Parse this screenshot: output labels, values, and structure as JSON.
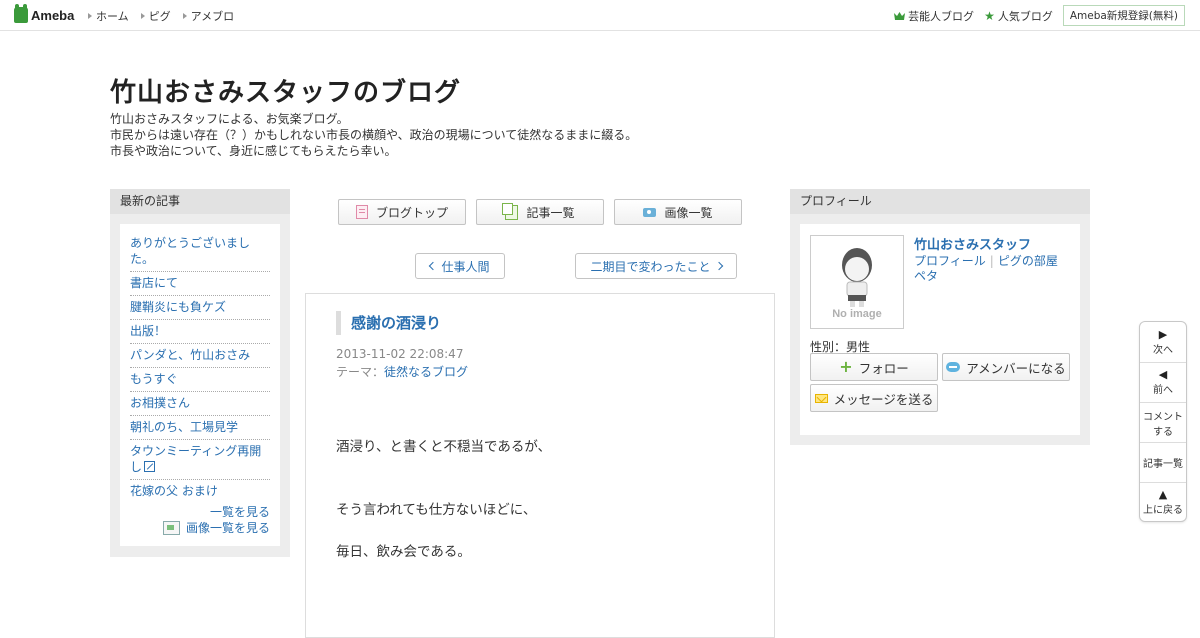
{
  "topbar": {
    "logo": "Ameba",
    "nav": [
      "ホーム",
      "ピグ",
      "アメブロ"
    ],
    "right": {
      "celeb_blog": "芸能人ブログ",
      "popular_blog": "人気ブログ",
      "register": "Ameba新規登録(無料)"
    }
  },
  "header": {
    "title": "竹山おさみスタッフのブログ",
    "description": [
      "竹山おさみスタッフによる、お気楽ブログ。",
      "市民からは遠い存在（？）かもしれない市長の横顔や、政治の現場について徒然なるままに綴る。",
      "市長や政治について、身近に感じてもらえたら幸い。"
    ]
  },
  "recent": {
    "heading": "最新の記事",
    "items": [
      "ありがとうございました。",
      "書店にて",
      "腱鞘炎にも負ケズ",
      "出版！",
      "パンダと、竹山おさみ",
      "もうすぐ",
      "お相撲さん",
      "朝礼のち、工場見学",
      "タウンミーティング再開し",
      "花嫁の父 おまけ"
    ],
    "see_list": "一覧を見る",
    "see_images": "画像一覧を見る"
  },
  "tabs": {
    "blog_top": "ブログトップ",
    "entry_list": "記事一覧",
    "image_list": "画像一覧"
  },
  "pager": {
    "prev": "仕事人間",
    "next": "二期目で変わったこと"
  },
  "article": {
    "title": "感謝の酒浸り",
    "date": "2013-11-02 22:08:47",
    "theme_label": "テーマ：",
    "theme": "徒然なるブログ",
    "body": [
      "酒浸り、と書くと不穏当であるが、",
      "そう言われても仕方ないほどに、",
      "毎日、飲み会である。"
    ]
  },
  "profile": {
    "heading": "プロフィール",
    "name": "竹山おさみスタッフ",
    "link_profile": "プロフィール",
    "link_pig": "ピグの部屋",
    "link_peta": "ペタ",
    "no_image": "No image",
    "gender": "性別：男性",
    "follow": "フォロー",
    "member": "アメンバーになる",
    "message": "メッセージを送る"
  },
  "floatnav": {
    "next": "次へ",
    "prev": "前へ",
    "comment_1": "コメント",
    "comment_2": "する",
    "entry_list": "記事一覧",
    "top": "上に戻る"
  },
  "colors": {
    "link": "#2a6fb0",
    "brand_green": "#3b9a3b",
    "panel_gray": "#ededed"
  }
}
